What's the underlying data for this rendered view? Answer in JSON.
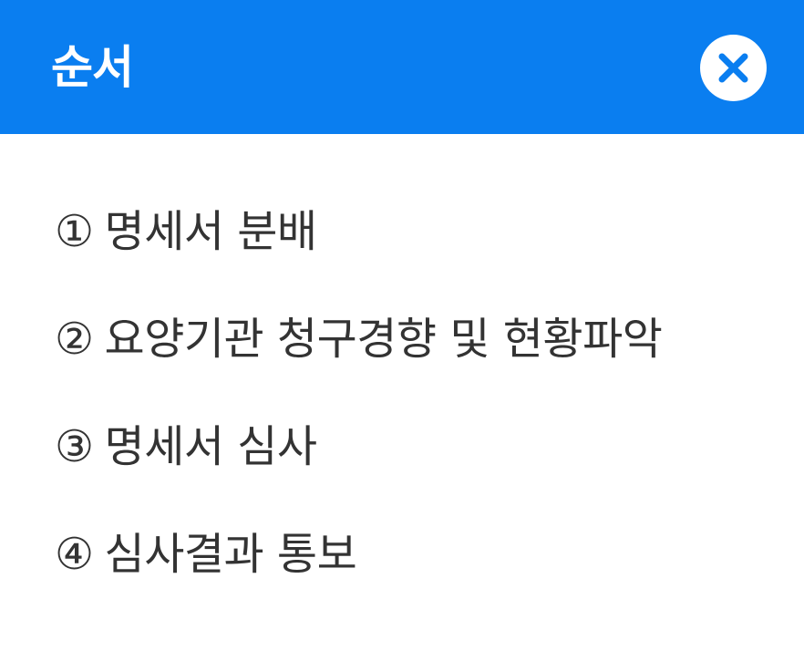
{
  "header": {
    "title": "순서",
    "close_icon": "close-icon",
    "accent_color": "#0a7ef0"
  },
  "steps": [
    {
      "number": "①",
      "label": "명세서 분배"
    },
    {
      "number": "②",
      "label": "요양기관 청구경향 및 현황파악"
    },
    {
      "number": "③",
      "label": "명세서 심사"
    },
    {
      "number": "④",
      "label": "심사결과 통보"
    }
  ]
}
